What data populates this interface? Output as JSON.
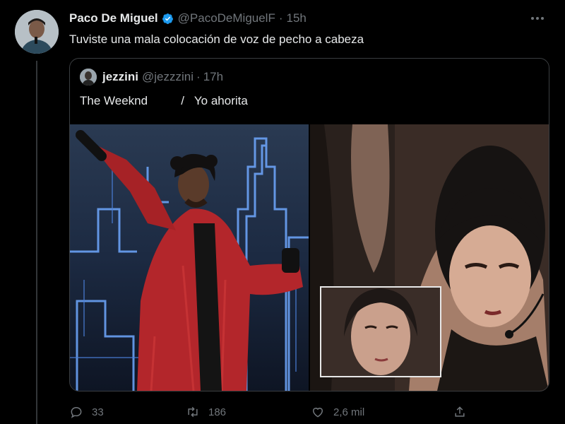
{
  "tweet": {
    "author_name": "Paco De Miguel",
    "author_handle": "@PacoDeMiguelF",
    "separator": "·",
    "time": "15h",
    "text": "Tuviste una mala colocación de voz de pecho a cabeza"
  },
  "quoted": {
    "author_name": "jezzini",
    "author_handle": "@jezzzini",
    "separator": "·",
    "time": "17h",
    "text": "The Weeknd          /   Yo ahorita"
  },
  "actions": {
    "replies": "33",
    "retweets": "186",
    "likes": "2,6 mil"
  },
  "icons": [
    "verified-badge-icon",
    "more-options-icon",
    "reply-icon",
    "retweet-icon",
    "like-icon",
    "share-icon"
  ],
  "colors": {
    "background": "#000000",
    "verified": "#1d9bf0",
    "muted": "#71767b",
    "text": "#e7e9ea"
  }
}
